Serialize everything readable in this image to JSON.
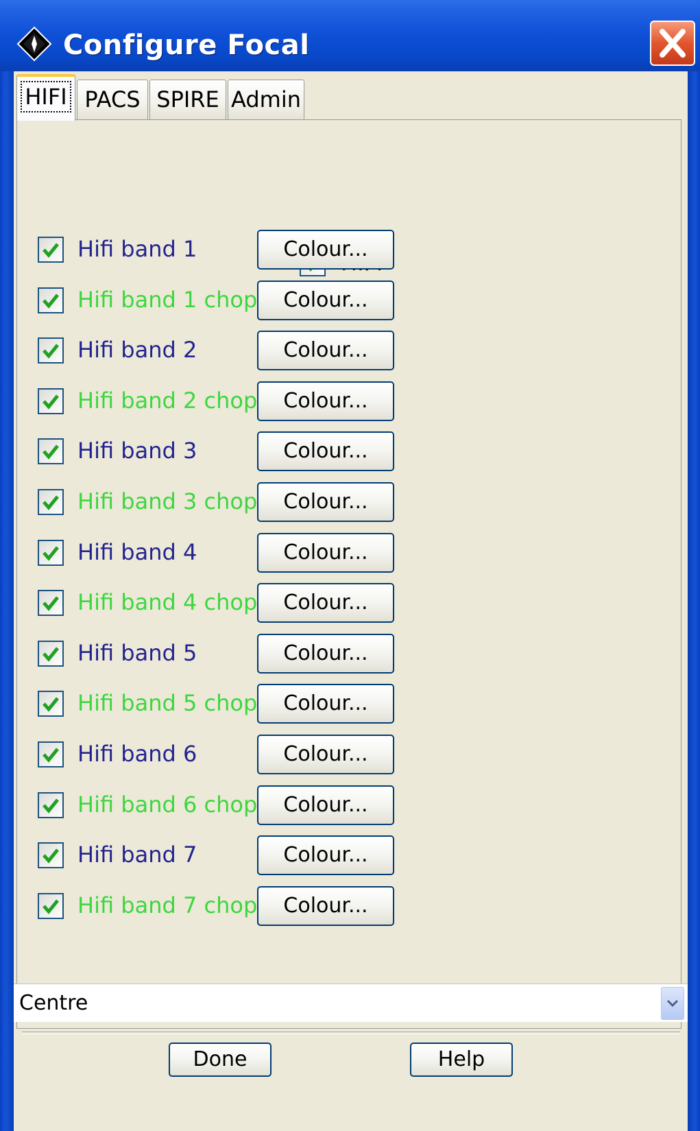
{
  "window": {
    "title": "Configure Focal"
  },
  "tabs": [
    "HIFI",
    "PACS",
    "SPIRE",
    "Admin"
  ],
  "active_tab": "HIFI",
  "colors": {
    "band_label": "#23238f",
    "chop_label": "#3ed63e",
    "checkmark": "#21a121"
  },
  "hifi_panel": {
    "master_checkbox": {
      "label": "HIFI",
      "checked": true
    },
    "rows": [
      {
        "label": "Hifi band 1",
        "kind": "band",
        "checked": true,
        "button": "Colour..."
      },
      {
        "label": "Hifi band 1 chop",
        "kind": "chop",
        "checked": true,
        "button": "Colour..."
      },
      {
        "label": "Hifi band 2",
        "kind": "band",
        "checked": true,
        "button": "Colour..."
      },
      {
        "label": "Hifi band 2 chop",
        "kind": "chop",
        "checked": true,
        "button": "Colour..."
      },
      {
        "label": "Hifi band 3",
        "kind": "band",
        "checked": true,
        "button": "Colour..."
      },
      {
        "label": "Hifi band 3 chop",
        "kind": "chop",
        "checked": true,
        "button": "Colour..."
      },
      {
        "label": "Hifi band 4",
        "kind": "band",
        "checked": true,
        "button": "Colour..."
      },
      {
        "label": "Hifi band 4 chop",
        "kind": "chop",
        "checked": true,
        "button": "Colour..."
      },
      {
        "label": "Hifi band 5",
        "kind": "band",
        "checked": true,
        "button": "Colour..."
      },
      {
        "label": "Hifi band 5 chop",
        "kind": "chop",
        "checked": true,
        "button": "Colour..."
      },
      {
        "label": "Hifi band 6",
        "kind": "band",
        "checked": true,
        "button": "Colour..."
      },
      {
        "label": "Hifi band 6 chop",
        "kind": "chop",
        "checked": true,
        "button": "Colour..."
      },
      {
        "label": "Hifi band 7",
        "kind": "band",
        "checked": true,
        "button": "Colour..."
      },
      {
        "label": "Hifi band 7 chop",
        "kind": "chop",
        "checked": true,
        "button": "Colour..."
      }
    ]
  },
  "position_select": {
    "value": "Centre"
  },
  "footer": {
    "done_label": "Done",
    "help_label": "Help"
  }
}
